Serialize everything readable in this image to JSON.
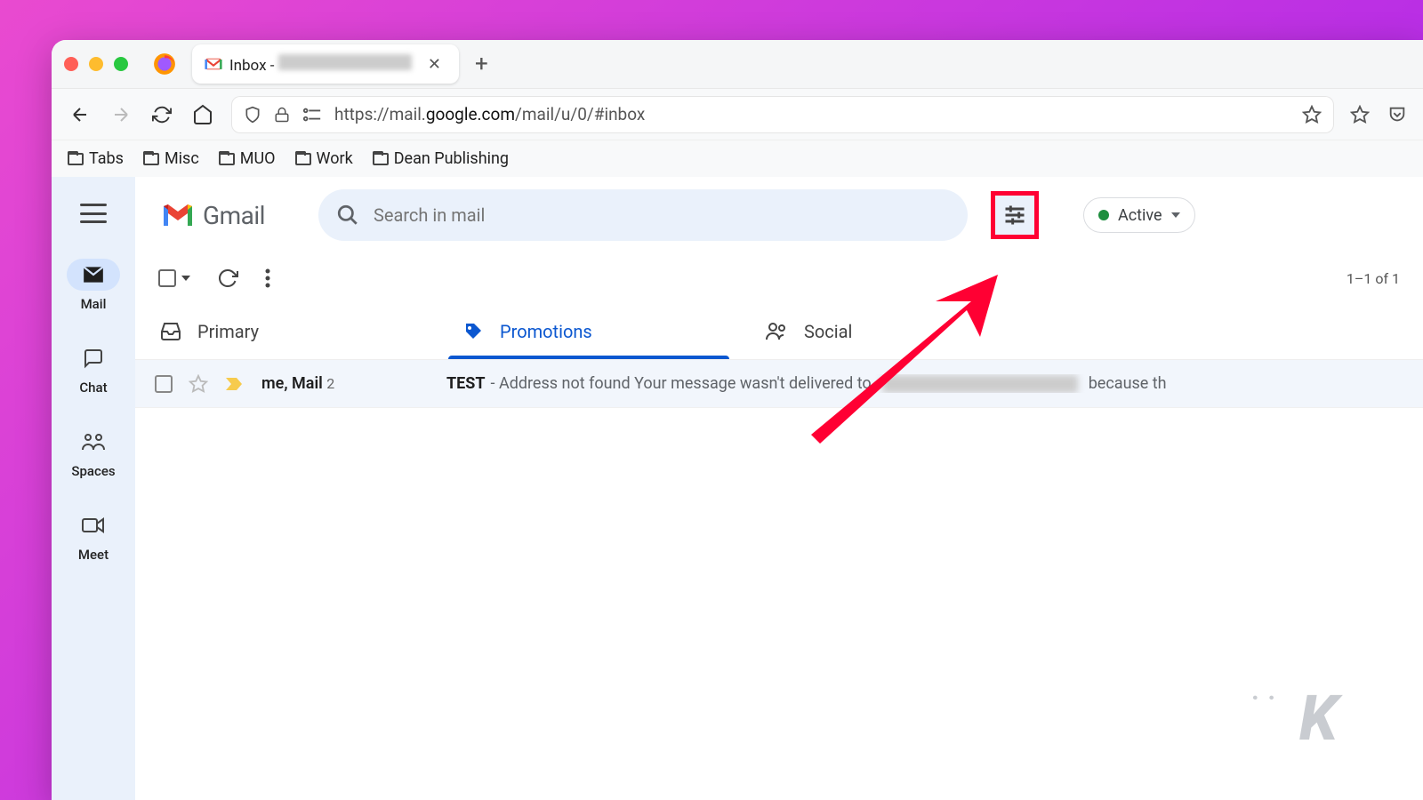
{
  "browser": {
    "tab_title_prefix": "Inbox - ",
    "url_prefix": "https://mail.",
    "url_bold": "google.com",
    "url_suffix": "/mail/u/0/#inbox"
  },
  "bookmarks": [
    "Tabs",
    "Misc",
    "MUO",
    "Work",
    "Dean Publishing"
  ],
  "gmail": {
    "app_name": "Gmail",
    "search_placeholder": "Search in mail",
    "status_label": "Active",
    "rail": [
      {
        "label": "Mail",
        "active": true
      },
      {
        "label": "Chat",
        "active": false
      },
      {
        "label": "Spaces",
        "active": false
      },
      {
        "label": "Meet",
        "active": false
      }
    ],
    "pager": "1–1 of 1",
    "tabs": [
      {
        "label": "Primary",
        "active": false
      },
      {
        "label": "Promotions",
        "active": true
      },
      {
        "label": "Social",
        "active": false
      }
    ],
    "messages": [
      {
        "sender": "me, Mail",
        "count": "2",
        "subject": "TEST",
        "snippet_before": " - Address not found Your message wasn't delivered to ",
        "snippet_after": "because th"
      }
    ]
  },
  "watermark": "K"
}
